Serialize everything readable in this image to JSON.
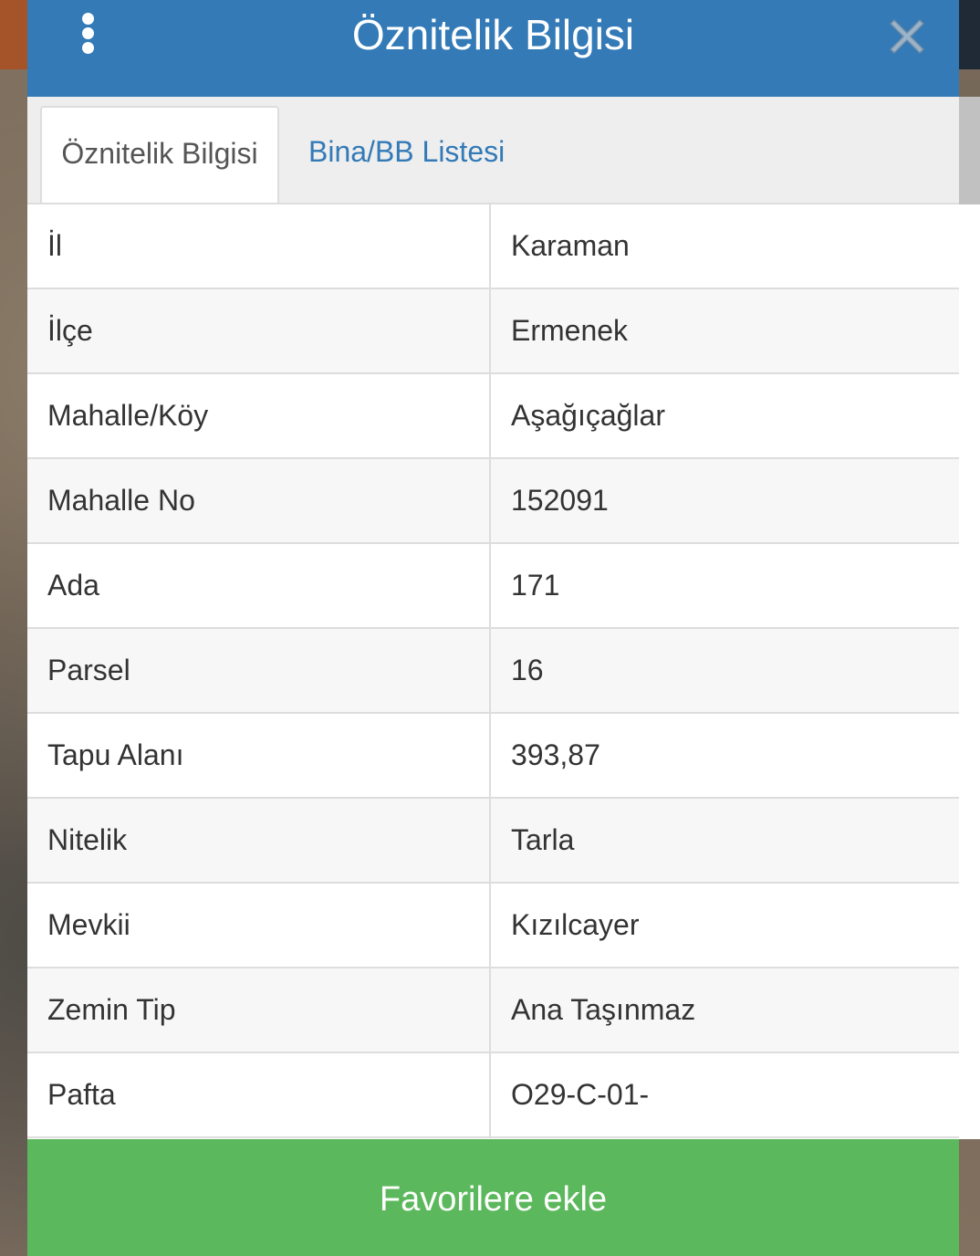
{
  "header": {
    "title": "Öznitelik Bilgisi",
    "menu_icon": "kebab-menu-icon",
    "close_icon": "close-icon"
  },
  "tabs": [
    {
      "label": "Öznitelik Bilgisi",
      "active": true
    },
    {
      "label": "Bina/BB Listesi",
      "active": false
    }
  ],
  "attributes": [
    {
      "key": "İl",
      "value": "Karaman"
    },
    {
      "key": "İlçe",
      "value": "Ermenek"
    },
    {
      "key": "Mahalle/Köy",
      "value": "Aşağıçağlar"
    },
    {
      "key": "Mahalle No",
      "value": "152091"
    },
    {
      "key": "Ada",
      "value": "171"
    },
    {
      "key": "Parsel",
      "value": "16"
    },
    {
      "key": "Tapu Alanı",
      "value": "393,87"
    },
    {
      "key": "Nitelik",
      "value": "Tarla"
    },
    {
      "key": "Mevkii",
      "value": "Kızılcayer"
    },
    {
      "key": "Zemin Tip",
      "value": "Ana Taşınmaz"
    },
    {
      "key": "Pafta",
      "value": "O29-C-01-"
    }
  ],
  "footer": {
    "favorite_label": "Favorilere ekle"
  },
  "colors": {
    "header_bg": "#337ab7",
    "tab_link": "#337ab7",
    "footer_bg": "#5cb85c"
  }
}
